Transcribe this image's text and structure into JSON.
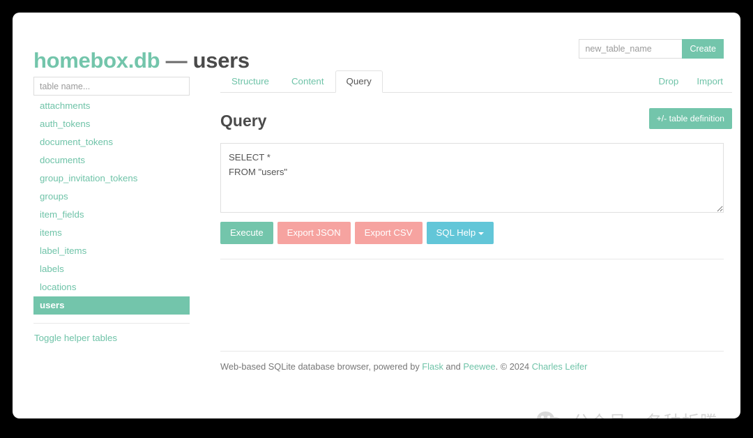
{
  "header": {
    "db_name": "homebox.db",
    "separator": "—",
    "table_name": "users",
    "create_input_placeholder": "new_table_name",
    "create_button": "Create"
  },
  "sidebar": {
    "filter_placeholder": "table name...",
    "tables": [
      {
        "label": "attachments",
        "active": false
      },
      {
        "label": "auth_tokens",
        "active": false
      },
      {
        "label": "document_tokens",
        "active": false
      },
      {
        "label": "documents",
        "active": false
      },
      {
        "label": "group_invitation_tokens",
        "active": false
      },
      {
        "label": "groups",
        "active": false
      },
      {
        "label": "item_fields",
        "active": false
      },
      {
        "label": "items",
        "active": false
      },
      {
        "label": "label_items",
        "active": false
      },
      {
        "label": "labels",
        "active": false
      },
      {
        "label": "locations",
        "active": false
      },
      {
        "label": "users",
        "active": true
      }
    ],
    "toggle_helper_tables": "Toggle helper tables"
  },
  "tabs": {
    "left": [
      {
        "label": "Structure",
        "active": false
      },
      {
        "label": "Content",
        "active": false
      },
      {
        "label": "Query",
        "active": true
      }
    ],
    "right": [
      {
        "label": "Drop"
      },
      {
        "label": "Import"
      }
    ]
  },
  "query": {
    "heading": "Query",
    "table_definition_button": "+/- table definition",
    "sql_text": "SELECT *\nFROM \"users\"",
    "buttons": {
      "execute": "Execute",
      "export_json": "Export JSON",
      "export_csv": "Export CSV",
      "sql_help": "SQL Help"
    }
  },
  "footer": {
    "text_start": "Web-based SQLite database browser, powered by ",
    "link_flask": "Flask",
    "text_and": " and ",
    "link_peewee": "Peewee",
    "text_copyright": ". © 2024 ",
    "link_author": "Charles Leifer"
  },
  "watermark": {
    "text": "公众号 · 各种折腾"
  },
  "colors": {
    "accent_teal": "#73c5ab",
    "danger_salmon": "#f6a3a0",
    "info_cyan": "#62c6d8",
    "text_dark": "#4a4a4a",
    "page_background": "#000000"
  }
}
